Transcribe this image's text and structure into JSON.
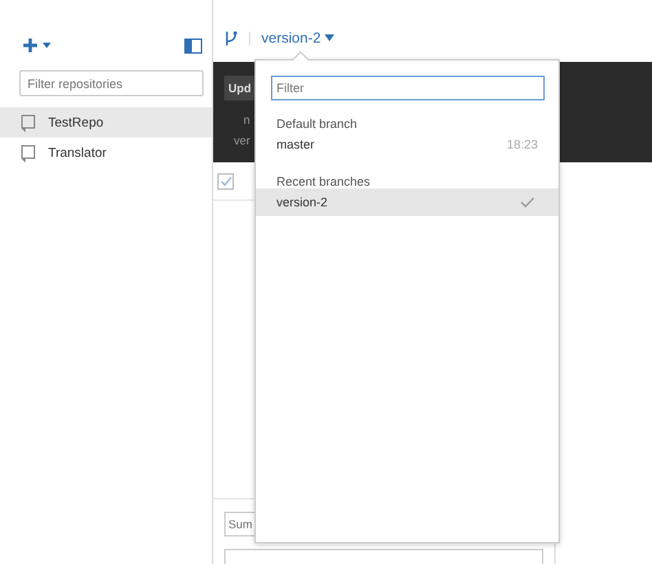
{
  "sidebar": {
    "filter": {
      "placeholder": "Filter repositories"
    },
    "repositories": [
      {
        "name": "TestRepo",
        "selected": true
      },
      {
        "name": "Translator",
        "selected": false
      }
    ]
  },
  "toolbar": {
    "branch": "version-2"
  },
  "header": {
    "button": "Upd",
    "line_1": "n",
    "line_2": "ver"
  },
  "changes": {
    "select_all_checked": true
  },
  "commit": {
    "summary_placeholder": "Sum"
  },
  "branch_menu": {
    "filter": {
      "placeholder": "Filter"
    },
    "sections": [
      {
        "title": "Default branch",
        "branches": [
          {
            "name": "master",
            "time": "18:23",
            "selected": false
          }
        ]
      },
      {
        "title": "Recent branches",
        "branches": [
          {
            "name": "version-2",
            "selected": true
          }
        ]
      }
    ]
  }
}
